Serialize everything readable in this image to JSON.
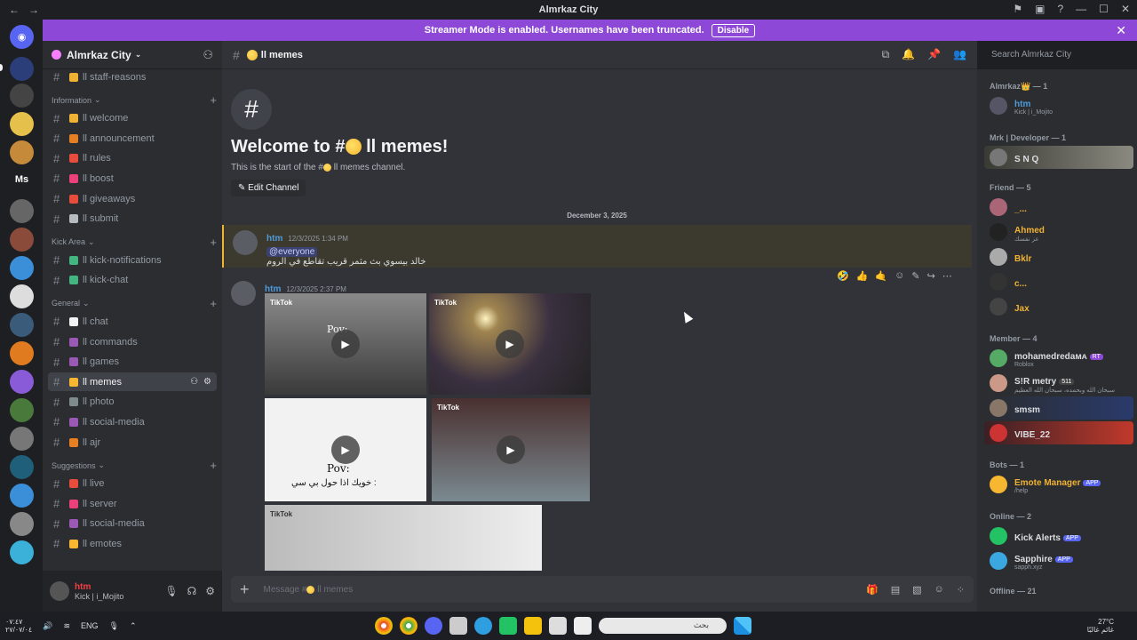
{
  "window": {
    "title": "Almrkaz City",
    "back": "←",
    "forward": "→"
  },
  "banner": {
    "text": "Streamer Mode is enabled. Usernames have been truncated.",
    "disable": "Disable"
  },
  "server": {
    "name": "Almrkaz City",
    "rail_label_ms": "Ms",
    "rail_badge": "1"
  },
  "sidebar": {
    "channels_top": [
      {
        "label": "ll staff-reasons",
        "emoji_color": "#f0b232"
      }
    ],
    "categories": [
      {
        "label": "Information",
        "channels": [
          {
            "label": "ll welcome",
            "emoji_color": "#f0b232"
          },
          {
            "label": "ll announcement",
            "emoji_color": "#e67e22"
          },
          {
            "label": "ll rules",
            "emoji_color": "#e74c3c"
          },
          {
            "label": "ll boost",
            "emoji_color": "#ec407a"
          },
          {
            "label": "ll giveaways",
            "emoji_color": "#e74c3c"
          },
          {
            "label": "ll submit",
            "emoji_color": "#b5bac1"
          }
        ]
      },
      {
        "label": "Kick Area",
        "channels": [
          {
            "label": "ll kick-notifications",
            "emoji_color": "#43b581"
          },
          {
            "label": "ll kick-chat",
            "emoji_color": "#43b581"
          }
        ]
      },
      {
        "label": "General",
        "channels": [
          {
            "label": "ll chat",
            "emoji_color": "#f2f3f5"
          },
          {
            "label": "ll commands",
            "emoji_color": "#9b59b6"
          },
          {
            "label": "ll games",
            "emoji_color": "#9b59b6"
          },
          {
            "label": "ll memes",
            "emoji_color": "#f7b731"
          },
          {
            "label": "ll photo",
            "emoji_color": "#7f8c8d"
          },
          {
            "label": "ll social-media",
            "emoji_color": "#9b59b6"
          },
          {
            "label": "ll ajr",
            "emoji_color": "#e67e22"
          }
        ]
      },
      {
        "label": "Suggestions",
        "channels": [
          {
            "label": "ll live",
            "emoji_color": "#e74c3c"
          },
          {
            "label": "ll server",
            "emoji_color": "#ec407a"
          },
          {
            "label": "ll social-media",
            "emoji_color": "#9b59b6"
          },
          {
            "label": "ll emotes",
            "emoji_color": "#f7b731"
          }
        ]
      }
    ]
  },
  "user_panel": {
    "name": "htm",
    "status": "Kick | i_Mojito"
  },
  "channel": {
    "name": "ll memes",
    "welcome_prefix": "Welcome to #",
    "welcome_name": " ll memes!",
    "desc_prefix": "This is the start of the #",
    "desc_suffix": " ll memes channel.",
    "edit": "Edit Channel",
    "date_divider": "December 3, 2025",
    "composer_placeholder_prefix": "Message #",
    "composer_placeholder_suffix": " ll memes"
  },
  "search": {
    "placeholder": "Search Almrkaz City"
  },
  "messages": [
    {
      "author": "htm",
      "timestamp": "12/3/2025 1:34 PM",
      "mention": "@everyone",
      "text": "خالد بيسوي بث مثمر قريب تقاطع في الروم"
    },
    {
      "author": "htm",
      "timestamp": "12/3/2025 2:37 PM"
    }
  ],
  "media": [
    {
      "overlay": "Pov:",
      "caption": "TikTok"
    },
    {
      "overlay": "",
      "caption": "TikTok"
    },
    {
      "overlay": "Pov:",
      "caption": "خويك اذا حول بي سي :"
    },
    {
      "overlay": "",
      "caption": "TikTok"
    },
    {
      "overlay": "",
      "caption": "TikTok"
    }
  ],
  "members": {
    "groups": [
      {
        "label": "Almrkaz👑 — 1"
      },
      {
        "label": "Mrk | Developer — 1"
      },
      {
        "label": "Friend — 5"
      },
      {
        "label": "Member — 4"
      },
      {
        "label": "Bots — 1"
      },
      {
        "label": "Online — 2"
      },
      {
        "label": "Offline — 21"
      }
    ],
    "people": [
      {
        "name": "htm",
        "status": "Kick | i_Mojito",
        "color": "#4e9bd9"
      },
      {
        "name": "S N Q",
        "status": "",
        "color": "#dbdee1"
      },
      {
        "name": "_...",
        "status": "",
        "color": "#f0b232"
      },
      {
        "name": "Ahmed",
        "status": "عز نفسك",
        "color": "#f0b232"
      },
      {
        "name": "Bklr",
        "status": "",
        "color": "#f0b232"
      },
      {
        "name": "c...",
        "status": "",
        "color": "#f0b232"
      },
      {
        "name": "Jax",
        "status": "",
        "color": "#f0b232"
      },
      {
        "name": "mohamedredaᴍᴀ",
        "status": "Roblox",
        "color": "#dbdee1"
      },
      {
        "name": "S!R metry",
        "status": "سبحان الله وبحمده، سبحان الله العظيم",
        "color": "#dbdee1"
      },
      {
        "name": "smsm",
        "status": "",
        "color": "#dbdee1"
      },
      {
        "name": "VIBE_22",
        "status": "",
        "color": "#dbdee1"
      },
      {
        "name": "Emote Manager",
        "status": "/help",
        "color": "#f0b232",
        "app": "APP"
      },
      {
        "name": "Kick Alerts",
        "status": "",
        "color": "#dbdee1",
        "app": "APP"
      },
      {
        "name": "Sapphire",
        "status": "sapph.xyz",
        "color": "#dbdee1",
        "app": "APP"
      }
    ],
    "badges": {
      "rt": "RT",
      "num": "511"
    }
  },
  "taskbar": {
    "time": "٠٧:٤٧",
    "date": "٢٧/٠٧/٠٤",
    "lang": "ENG",
    "search": "بحث",
    "temp": "27°C",
    "weather": "غائم غالبًا"
  }
}
